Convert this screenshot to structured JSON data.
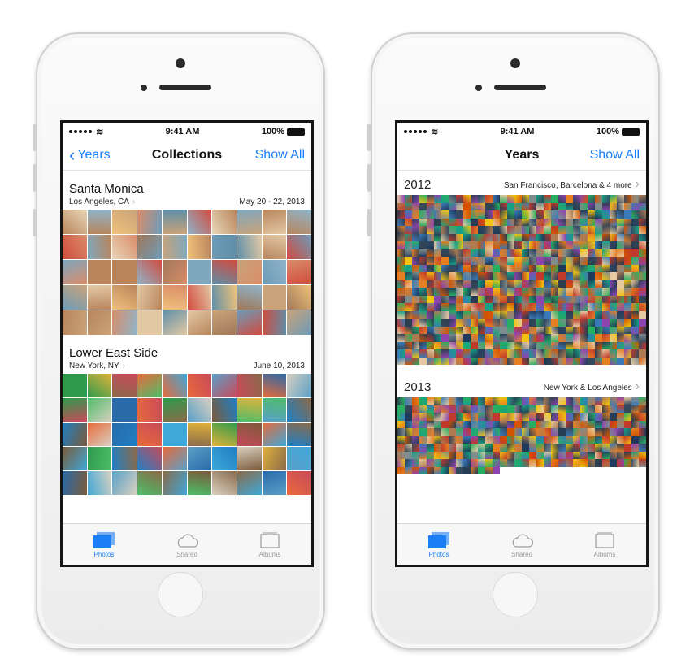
{
  "status_bar": {
    "time": "9:41 AM",
    "battery": "100%"
  },
  "left_screen": {
    "nav": {
      "back_label": "Years",
      "title": "Collections",
      "action_label": "Show All"
    },
    "collections": [
      {
        "title": "Santa Monica",
        "location": "Los Angeles, CA",
        "date": "May 20 - 22, 2013"
      },
      {
        "title": "Lower East Side",
        "location": "New York, NY",
        "date": "June 10, 2013"
      }
    ]
  },
  "right_screen": {
    "nav": {
      "title": "Years",
      "action_label": "Show All"
    },
    "years": [
      {
        "year": "2012",
        "places": "San Francisco, Barcelona & 4 more"
      },
      {
        "year": "2013",
        "places": "New York & Los Angeles"
      }
    ]
  },
  "tabbar": {
    "tabs": [
      {
        "label": "Photos",
        "icon": "photos-icon",
        "active": true
      },
      {
        "label": "Shared",
        "icon": "cloud-icon",
        "active": false
      },
      {
        "label": "Albums",
        "icon": "album-icon",
        "active": false
      }
    ]
  },
  "colors": {
    "accent": "#1a7ef6",
    "screen_border": "#151515"
  }
}
